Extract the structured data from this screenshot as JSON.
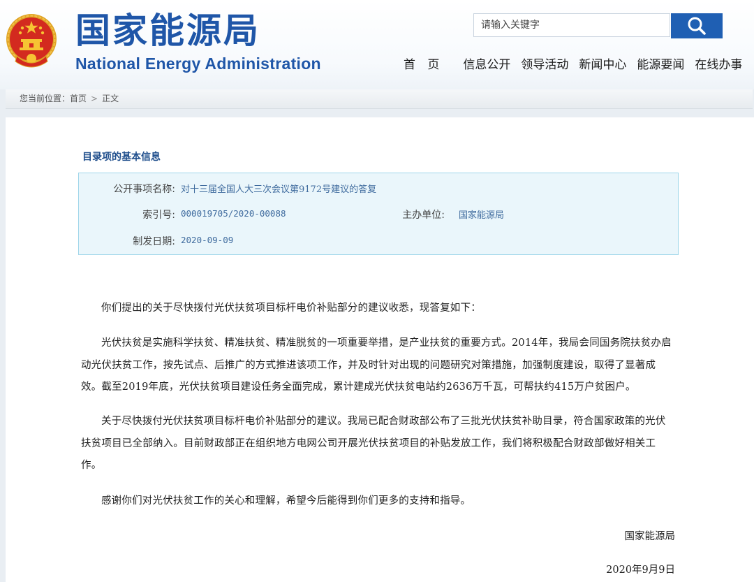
{
  "header": {
    "logo_cn": "国家能源局",
    "logo_en": "National Energy Administration",
    "search_placeholder": "请输入关键字",
    "nav": [
      "首 页",
      "信息公开",
      "领导活动",
      "新闻中心",
      "能源要闻",
      "在线办事"
    ]
  },
  "breadcrumb": {
    "label": "您当前位置：",
    "home": "首页",
    "separator": ">",
    "current": "正文"
  },
  "info": {
    "section_title": "目录项的基本信息",
    "item_name_label": "公开事项名称:",
    "item_name_value": "对十三届全国人大三次会议第9172号建议的答复",
    "index_label": "索引号:",
    "index_value": "000019705/2020-00088",
    "org_label": "主办单位:",
    "org_value": "国家能源局",
    "date_label": "制发日期:",
    "date_value": "2020-09-09"
  },
  "article": {
    "paragraphs": [
      "你们提出的关于尽快拨付光伏扶贫项目标杆电价补贴部分的建议收悉，现答复如下：",
      "光伏扶贫是实施科学扶贫、精准扶贫、精准脱贫的一项重要举措，是产业扶贫的重要方式。2014年，我局会同国务院扶贫办启动光伏扶贫工作，按先试点、后推广的方式推进该项工作，并及时针对出现的问题研究对策措施，加强制度建设，取得了显著成效。截至2019年底，光伏扶贫项目建设任务全面完成，累计建成光伏扶贫电站约2636万千瓦，可帮扶约415万户贫困户。",
      "关于尽快拨付光伏扶贫项目标杆电价补贴部分的建议。我局已配合财政部公布了三批光伏扶贫补助目录，符合国家政策的光伏扶贫项目已全部纳入。目前财政部正在组织地方电网公司开展光伏扶贫项目的补贴发放工作，我们将积极配合财政部做好相关工作。",
      "感谢你们对光伏扶贫工作的关心和理解，希望今后能得到你们更多的支持和指导。"
    ],
    "signature": "国家能源局",
    "sign_date": "2020年9月9日"
  },
  "colors": {
    "brand_blue": "#1f56a8",
    "search_button": "#1f5fb3",
    "info_box_bg": "#eaf6fb",
    "info_box_border": "#9fd6ea"
  }
}
